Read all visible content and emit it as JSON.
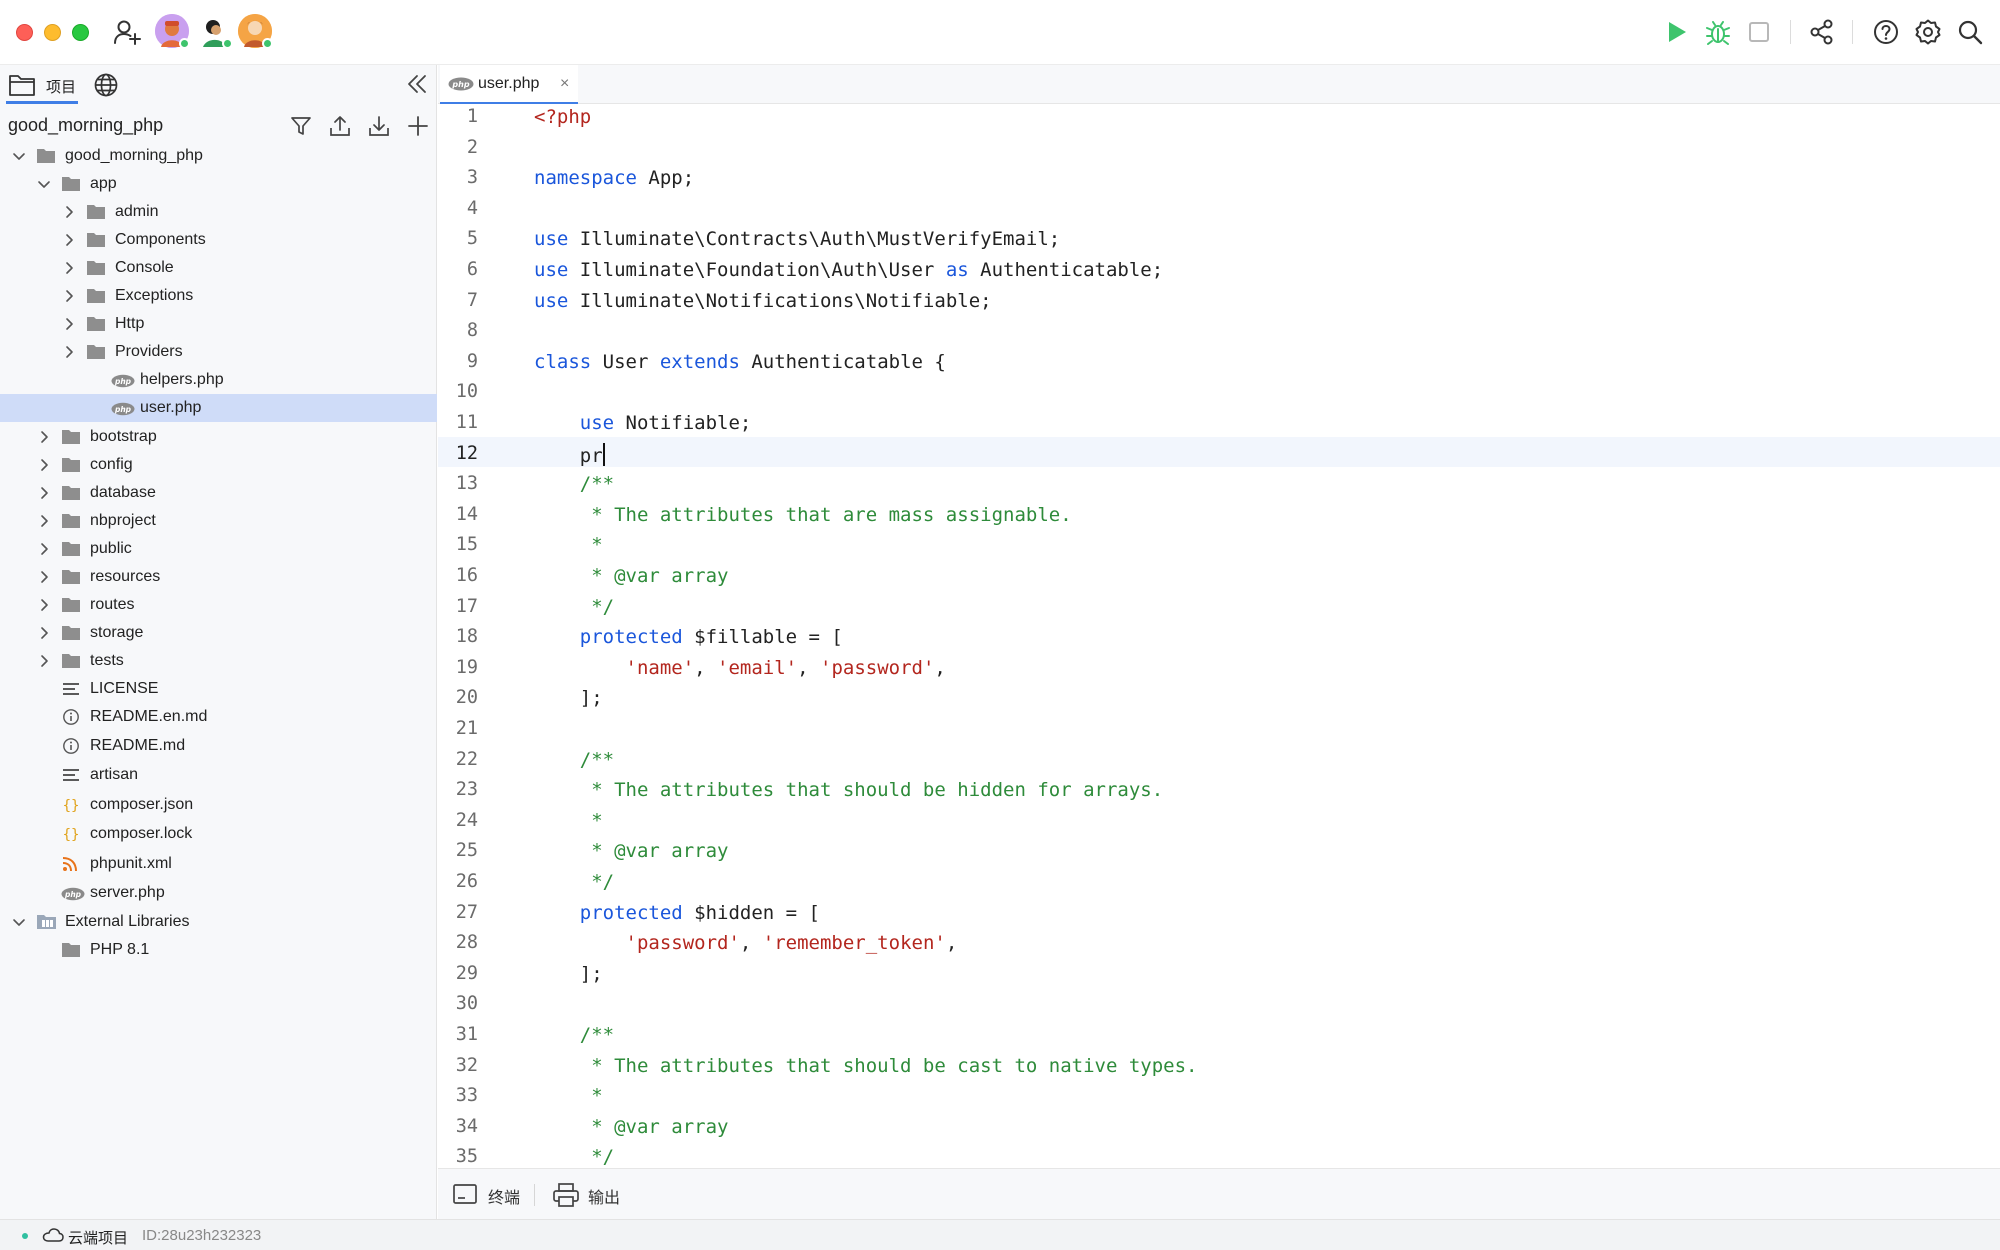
{
  "toolbar": {
    "avatars": [
      {
        "name": "collaborator-1",
        "status": "online"
      },
      {
        "name": "collaborator-2",
        "status": "online"
      },
      {
        "name": "collaborator-3",
        "status": "online"
      }
    ],
    "run_color": "#3ec46d"
  },
  "sidebar": {
    "tab_project_label": "项目",
    "project_name": "good_morning_php",
    "tree": [
      {
        "label": "good_morning_php",
        "type": "folder",
        "depth": 0,
        "expanded": true
      },
      {
        "label": "app",
        "type": "folder",
        "depth": 1,
        "expanded": true
      },
      {
        "label": "admin",
        "type": "folder",
        "depth": 2,
        "expanded": false
      },
      {
        "label": "Components",
        "type": "folder",
        "depth": 2,
        "expanded": false
      },
      {
        "label": "Console",
        "type": "folder",
        "depth": 2,
        "expanded": false
      },
      {
        "label": "Exceptions",
        "type": "folder",
        "depth": 2,
        "expanded": false
      },
      {
        "label": "Http",
        "type": "folder",
        "depth": 2,
        "expanded": false
      },
      {
        "label": "Providers",
        "type": "folder",
        "depth": 2,
        "expanded": false
      },
      {
        "label": "helpers.php",
        "type": "php",
        "depth": 3
      },
      {
        "label": "user.php",
        "type": "php",
        "depth": 3,
        "selected": true
      },
      {
        "label": "bootstrap",
        "type": "folder",
        "depth": 1,
        "expanded": false
      },
      {
        "label": "config",
        "type": "folder",
        "depth": 1,
        "expanded": false
      },
      {
        "label": "database",
        "type": "folder",
        "depth": 1,
        "expanded": false
      },
      {
        "label": "nbproject",
        "type": "folder",
        "depth": 1,
        "expanded": false
      },
      {
        "label": "public",
        "type": "folder",
        "depth": 1,
        "expanded": false
      },
      {
        "label": "resources",
        "type": "folder",
        "depth": 1,
        "expanded": false
      },
      {
        "label": "routes",
        "type": "folder",
        "depth": 1,
        "expanded": false
      },
      {
        "label": "storage",
        "type": "folder",
        "depth": 1,
        "expanded": false
      },
      {
        "label": "tests",
        "type": "folder",
        "depth": 1,
        "expanded": false
      },
      {
        "label": "LICENSE",
        "type": "text",
        "depth": 1
      },
      {
        "label": "README.en.md",
        "type": "info",
        "depth": 1
      },
      {
        "label": "README.md",
        "type": "info",
        "depth": 1
      },
      {
        "label": "artisan",
        "type": "text",
        "depth": 1
      },
      {
        "label": "composer.json",
        "type": "json",
        "depth": 1
      },
      {
        "label": "composer.lock",
        "type": "json",
        "depth": 1
      },
      {
        "label": "phpunit.xml",
        "type": "rss",
        "depth": 1
      },
      {
        "label": "server.php",
        "type": "php",
        "depth": 1
      },
      {
        "label": "External Libraries",
        "type": "library",
        "depth": 0,
        "expanded": true
      },
      {
        "label": "PHP 8.1",
        "type": "folder",
        "depth": 1
      }
    ]
  },
  "editor": {
    "open_tab": "user.php",
    "current_line": 12,
    "lines": [
      [
        [
          "tag",
          "<?php"
        ]
      ],
      [],
      [
        [
          "kw",
          "namespace"
        ],
        [
          "t",
          " App;"
        ]
      ],
      [],
      [
        [
          "kw",
          "use"
        ],
        [
          "t",
          " Illuminate\\Contracts\\Auth\\MustVerifyEmail;"
        ]
      ],
      [
        [
          "kw",
          "use"
        ],
        [
          "t",
          " Illuminate\\Foundation\\Auth\\User "
        ],
        [
          "kw",
          "as"
        ],
        [
          "t",
          " Authenticatable;"
        ]
      ],
      [
        [
          "kw",
          "use"
        ],
        [
          "t",
          " Illuminate\\Notifications\\Notifiable;"
        ]
      ],
      [],
      [
        [
          "kw",
          "class"
        ],
        [
          "t",
          " User "
        ],
        [
          "kw",
          "extends"
        ],
        [
          "t",
          " Authenticatable {"
        ]
      ],
      [],
      [
        [
          "t",
          "    "
        ],
        [
          "kw",
          "use"
        ],
        [
          "t",
          " Notifiable;"
        ]
      ],
      [
        [
          "t",
          "    pr"
        ],
        [
          "caret",
          ""
        ]
      ],
      [
        [
          "t",
          "    "
        ],
        [
          "cm",
          "/**"
        ]
      ],
      [
        [
          "t",
          "     "
        ],
        [
          "cm",
          "* The attributes that are mass assignable."
        ]
      ],
      [
        [
          "t",
          "     "
        ],
        [
          "cm",
          "*"
        ]
      ],
      [
        [
          "t",
          "     "
        ],
        [
          "cm",
          "* @var array"
        ]
      ],
      [
        [
          "t",
          "     "
        ],
        [
          "cm",
          "*/"
        ]
      ],
      [
        [
          "t",
          "    "
        ],
        [
          "kw",
          "protected"
        ],
        [
          "t",
          " $fillable = ["
        ]
      ],
      [
        [
          "t",
          "        "
        ],
        [
          "str",
          "'name'"
        ],
        [
          "t",
          ", "
        ],
        [
          "str",
          "'email'"
        ],
        [
          "t",
          ", "
        ],
        [
          "str",
          "'password'"
        ],
        [
          "t",
          ","
        ]
      ],
      [
        [
          "t",
          "    ];"
        ]
      ],
      [],
      [
        [
          "t",
          "    "
        ],
        [
          "cm",
          "/**"
        ]
      ],
      [
        [
          "t",
          "     "
        ],
        [
          "cm",
          "* The attributes that should be hidden for arrays."
        ]
      ],
      [
        [
          "t",
          "     "
        ],
        [
          "cm",
          "*"
        ]
      ],
      [
        [
          "t",
          "     "
        ],
        [
          "cm",
          "* @var array"
        ]
      ],
      [
        [
          "t",
          "     "
        ],
        [
          "cm",
          "*/"
        ]
      ],
      [
        [
          "t",
          "    "
        ],
        [
          "kw",
          "protected"
        ],
        [
          "t",
          " $hidden = ["
        ]
      ],
      [
        [
          "t",
          "        "
        ],
        [
          "str",
          "'password'"
        ],
        [
          "t",
          ", "
        ],
        [
          "str",
          "'remember_token'"
        ],
        [
          "t",
          ","
        ]
      ],
      [
        [
          "t",
          "    ];"
        ]
      ],
      [],
      [
        [
          "t",
          "    "
        ],
        [
          "cm",
          "/**"
        ]
      ],
      [
        [
          "t",
          "     "
        ],
        [
          "cm",
          "* The attributes that should be cast to native types."
        ]
      ],
      [
        [
          "t",
          "     "
        ],
        [
          "cm",
          "*"
        ]
      ],
      [
        [
          "t",
          "     "
        ],
        [
          "cm",
          "* @var array"
        ]
      ],
      [
        [
          "t",
          "     "
        ],
        [
          "cm",
          "*/"
        ]
      ]
    ]
  },
  "bottom": {
    "terminal_label": "终端",
    "output_label": "输出"
  },
  "status": {
    "project_label": "云端项目",
    "project_id": "ID:28u23h232323"
  }
}
